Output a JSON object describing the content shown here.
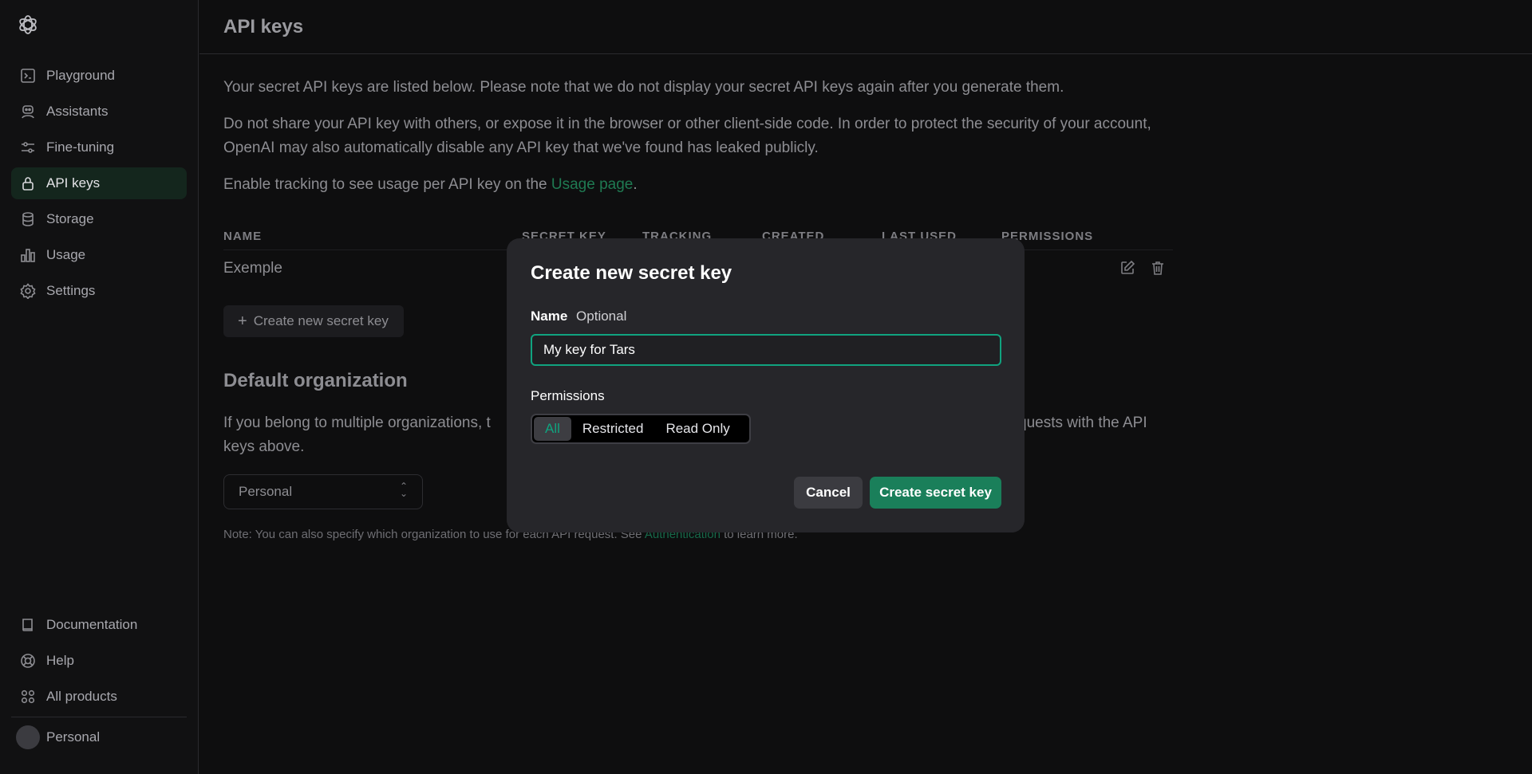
{
  "sidebar": {
    "logo_icon": "openai-logo-icon",
    "items": [
      {
        "label": "Playground",
        "icon": "terminal-icon"
      },
      {
        "label": "Assistants",
        "icon": "robot-icon"
      },
      {
        "label": "Fine-tuning",
        "icon": "sliders-icon"
      },
      {
        "label": "API keys",
        "icon": "lock-icon",
        "active": true
      },
      {
        "label": "Storage",
        "icon": "database-icon"
      },
      {
        "label": "Usage",
        "icon": "bar-chart-icon"
      },
      {
        "label": "Settings",
        "icon": "gear-icon"
      }
    ],
    "bottom_items": [
      {
        "label": "Documentation",
        "icon": "book-icon"
      },
      {
        "label": "Help",
        "icon": "lifebuoy-icon"
      },
      {
        "label": "All products",
        "icon": "grid-icon"
      }
    ],
    "user": {
      "label": "Personal"
    }
  },
  "header": {
    "title": "API keys"
  },
  "content": {
    "intro": "Your secret API keys are listed below. Please note that we do not display your secret API keys again after you generate them.",
    "warning": "Do not share your API key with others, or expose it in the browser or other client-side code. In order to protect the security of your account, OpenAI may also automatically disable any API key that we've found has leaked publicly.",
    "tracking_prefix": "Enable tracking to see usage per API key on the ",
    "tracking_link": "Usage page",
    "tracking_suffix": ".",
    "table": {
      "headers": [
        "NAME",
        "SECRET KEY",
        "TRACKING",
        "CREATED",
        "LAST USED",
        "PERMISSIONS"
      ],
      "rows": [
        {
          "name": "Exemple"
        }
      ]
    },
    "create_button": "Create new secret key",
    "default_org_title": "Default organization",
    "default_org_text_left": "If you belong to multiple organizations, t",
    "default_org_text_right": "quests with the API",
    "default_org_text_line2": "keys above.",
    "org_select_value": "Personal",
    "note_prefix": "Note: You can also specify which organization to use for each API request. See ",
    "note_link": "Authentication",
    "note_suffix": " to learn more."
  },
  "modal": {
    "title": "Create new secret key",
    "name_label": "Name",
    "name_sublabel": "Optional",
    "name_value": "My key for Tars",
    "permissions_label": "Permissions",
    "permission_options": [
      "All",
      "Restricted",
      "Read Only"
    ],
    "selected_permission": "All",
    "cancel": "Cancel",
    "create": "Create secret key"
  },
  "colors": {
    "accent": "#10a37f",
    "primary_button": "#1a7f5a",
    "active_nav_bg": "#14261d",
    "modal_bg": "#26262a"
  }
}
